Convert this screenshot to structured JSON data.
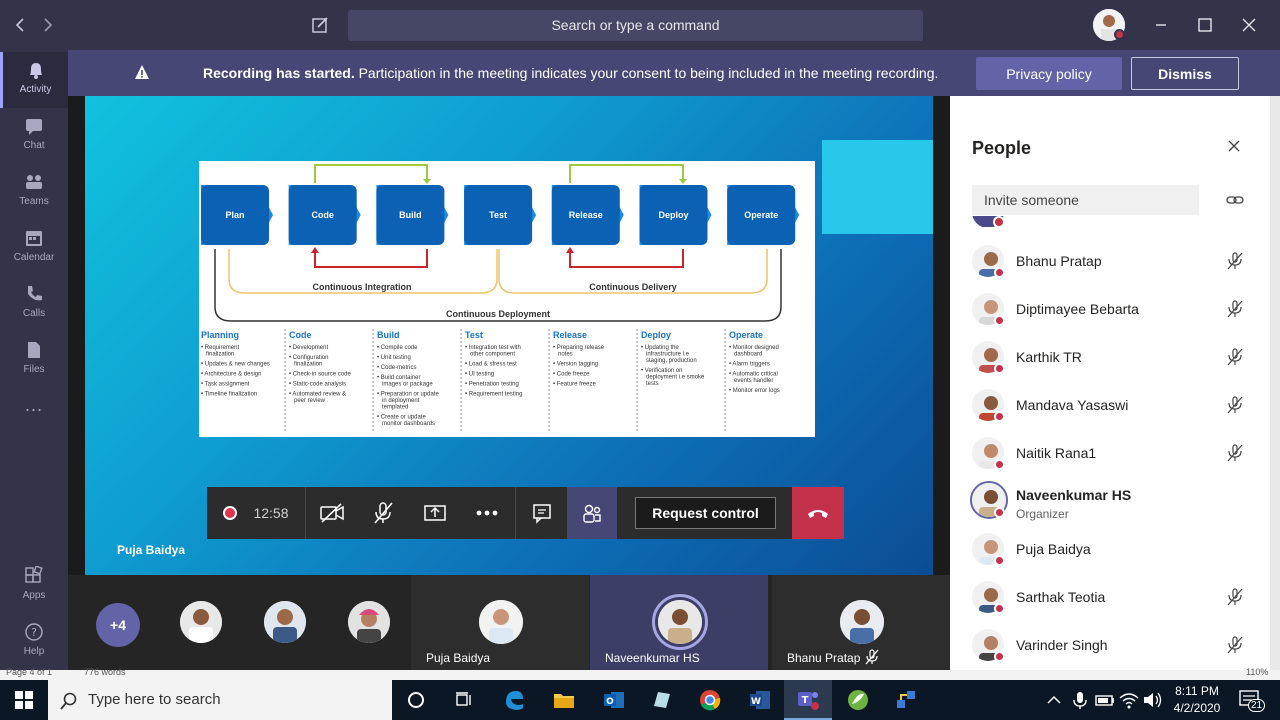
{
  "titlebar": {
    "search_placeholder": "Search or type a command"
  },
  "rail": {
    "items": [
      {
        "label": "Activity",
        "icon": "bell-icon"
      },
      {
        "label": "Chat",
        "icon": "chat-icon"
      },
      {
        "label": "Teams",
        "icon": "teams-icon"
      },
      {
        "label": "Calendar",
        "icon": "calendar-icon"
      },
      {
        "label": "Calls",
        "icon": "phone-icon"
      },
      {
        "label": "Files",
        "icon": "files-icon"
      },
      {
        "label": "...",
        "icon": "more-icon"
      },
      {
        "label": "Apps",
        "icon": "apps-icon"
      },
      {
        "label": "Help",
        "icon": "help-icon"
      }
    ]
  },
  "banner": {
    "bold": "Recording has started.",
    "text": "Participation in the meeting indicates your consent to being included in the meeting recording.",
    "privacy_label": "Privacy policy",
    "dismiss_label": "Dismiss"
  },
  "stage": {
    "presenter": "Puja Baidya"
  },
  "slide": {
    "stages": [
      "Plan",
      "Code",
      "Build",
      "Test",
      "Release",
      "Deploy",
      "Operate"
    ],
    "ci_label": "Continuous Integration",
    "cd_label": "Continuous Delivery",
    "deploy_label": "Continuous Deployment",
    "columns": [
      {
        "title": "Planning",
        "items": [
          "Requirement finalization",
          "Updates & new changes",
          "Architecture & design",
          "Task assignment",
          "Timeline finalization"
        ]
      },
      {
        "title": "Code",
        "items": [
          "Development",
          "Configuration finalization",
          "Check-in source code",
          "Static-code analysis",
          "Automated review & peer review"
        ]
      },
      {
        "title": "Build",
        "items": [
          "Compile code",
          "Unit testing",
          "Code-metrics",
          "Build container images or package",
          "Preparation or update in deployment templated",
          "Create or update monitor dashboards"
        ]
      },
      {
        "title": "Test",
        "items": [
          "Integration test with other component",
          "Load & stress test",
          "UI testing",
          "Penetration testing",
          "Requirement testing"
        ]
      },
      {
        "title": "Release",
        "items": [
          "Preparing release notes",
          "Version tagging",
          "Code freeze",
          "Feature freeze"
        ]
      },
      {
        "title": "Deploy",
        "items": [
          "Updating the infrastructure i.e staging, production",
          "Verification on deployment i.e smoke tests"
        ]
      },
      {
        "title": "Operate",
        "items": [
          "Monitor designed dashboard",
          "Alarm triggers",
          "Automatic critical events handler",
          "Monitor error logs"
        ]
      }
    ]
  },
  "controls": {
    "timer": "12:58",
    "request_control": "Request control"
  },
  "strip": {
    "more_count": "+4",
    "tiles": [
      {
        "name": "Puja Baidya"
      },
      {
        "name": "Naveenkumar HS"
      },
      {
        "name": "Bhanu Pratap"
      }
    ]
  },
  "pane": {
    "title": "People",
    "invite_placeholder": "Invite someone",
    "people": [
      {
        "name": "Bhanu Pratap",
        "role": ""
      },
      {
        "name": "Diptimayee Bebarta",
        "role": ""
      },
      {
        "name": "Karthik TR",
        "role": ""
      },
      {
        "name": "Mandava Yasaswi",
        "role": ""
      },
      {
        "name": "Naitik Rana1",
        "role": ""
      },
      {
        "name": "Naveenkumar HS",
        "role": "Organizer"
      },
      {
        "name": "Puja Baidya",
        "role": ""
      },
      {
        "name": "Sarthak Teotia",
        "role": ""
      },
      {
        "name": "Varinder Singh",
        "role": ""
      }
    ]
  },
  "behind": {
    "page": "Page 4 of 1",
    "words": "776 words",
    "zoom": "110%"
  },
  "taskbar": {
    "search_placeholder": "Type here to search",
    "time": "8:11 PM",
    "date": "4/2/2020",
    "notifications": "21"
  },
  "colors": {
    "accent": "#6264a7",
    "titlebar": "#33344a",
    "banner": "#464775",
    "hangup": "#c4314b",
    "slide_stage": "#0b62b5"
  }
}
